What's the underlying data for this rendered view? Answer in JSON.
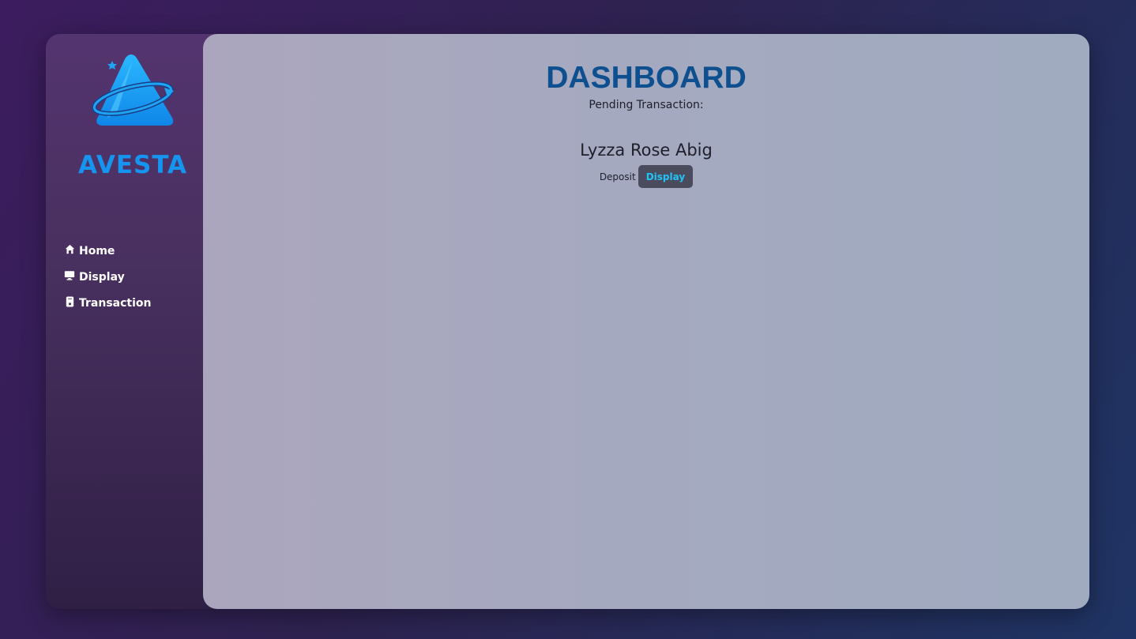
{
  "brand": {
    "name": "AVESTA",
    "logo_icon": "avesta-triangle-logo",
    "color": "#1594f0"
  },
  "sidebar": {
    "items": [
      {
        "label": "Home",
        "icon": "home-icon"
      },
      {
        "label": "Display",
        "icon": "monitor-icon"
      },
      {
        "label": "Transaction",
        "icon": "phone-icon"
      }
    ]
  },
  "main": {
    "title": "DASHBOARD",
    "subtitle": "Pending Transaction:",
    "transactions": [
      {
        "name": "Lyzza Rose Abig",
        "type": "Deposit",
        "action_label": "Display"
      }
    ]
  },
  "colors": {
    "title": "#0d4f8f",
    "button_bg": "#4a4c5e",
    "button_text": "#22c3f5"
  }
}
